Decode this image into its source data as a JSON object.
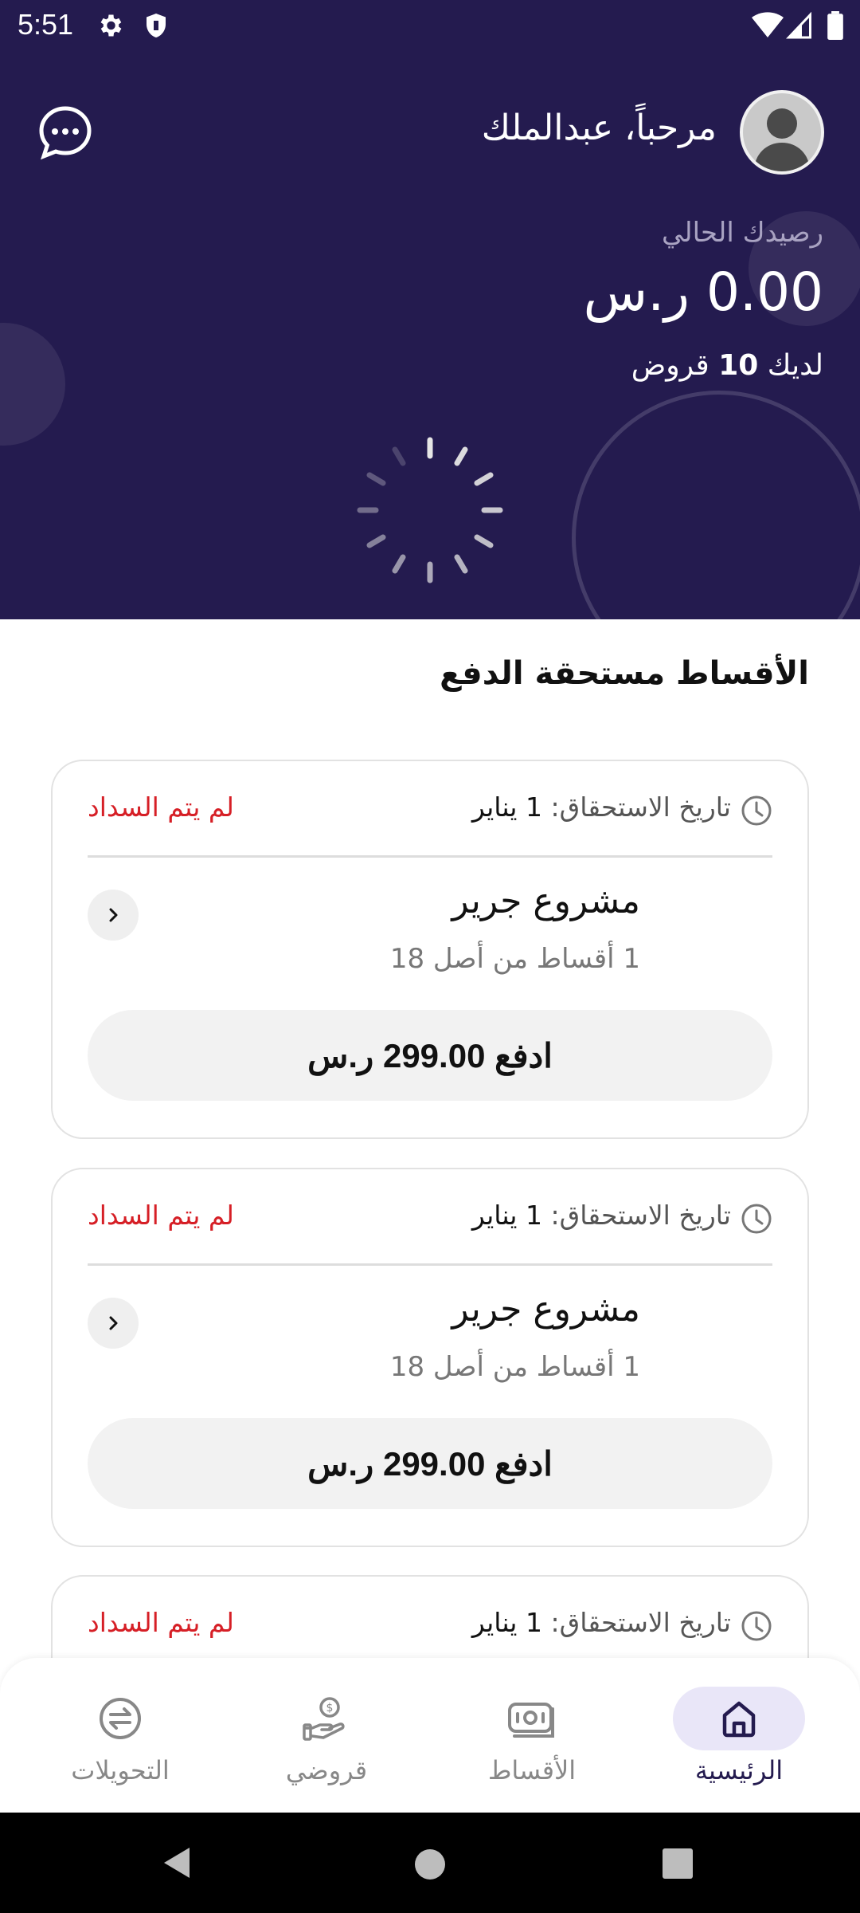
{
  "status_bar": {
    "time": "5:51"
  },
  "header": {
    "greeting": "مرحباً، عبدالملك",
    "balance_label": "رصيدك الحالي",
    "balance_value": "0.00 ر.س",
    "loans_prefix": "لديك",
    "loans_count": "10",
    "loans_suffix": "قروض"
  },
  "section": {
    "title": "الأقساط مستحقة الدفع"
  },
  "installments": [
    {
      "due_label": "تاريخ الاستحقاق:",
      "due_date": "1 يناير",
      "status": "لم يتم السداد",
      "project": "مشروع جرير",
      "count_text": "1 أقساط من أصل 18",
      "pay_label": "ادفع 299.00 ر.س"
    },
    {
      "due_label": "تاريخ الاستحقاق:",
      "due_date": "1 يناير",
      "status": "لم يتم السداد",
      "project": "مشروع جرير",
      "count_text": "1 أقساط من أصل 18",
      "pay_label": "ادفع 299.00 ر.س"
    },
    {
      "due_label": "تاريخ الاستحقاق:",
      "due_date": "1 يناير",
      "status": "لم يتم السداد"
    }
  ],
  "bottom_nav": {
    "items": [
      {
        "label": "الرئيسية",
        "icon": "home-icon",
        "active": true
      },
      {
        "label": "الأقساط",
        "icon": "installments-icon",
        "active": false
      },
      {
        "label": "قروضي",
        "icon": "loans-icon",
        "active": false
      },
      {
        "label": "التحويلات",
        "icon": "transfers-icon",
        "active": false
      }
    ]
  },
  "colors": {
    "header_bg": "#241b4f",
    "unpaid": "#d61f26",
    "active_nav_bg": "#e9e6f8"
  }
}
